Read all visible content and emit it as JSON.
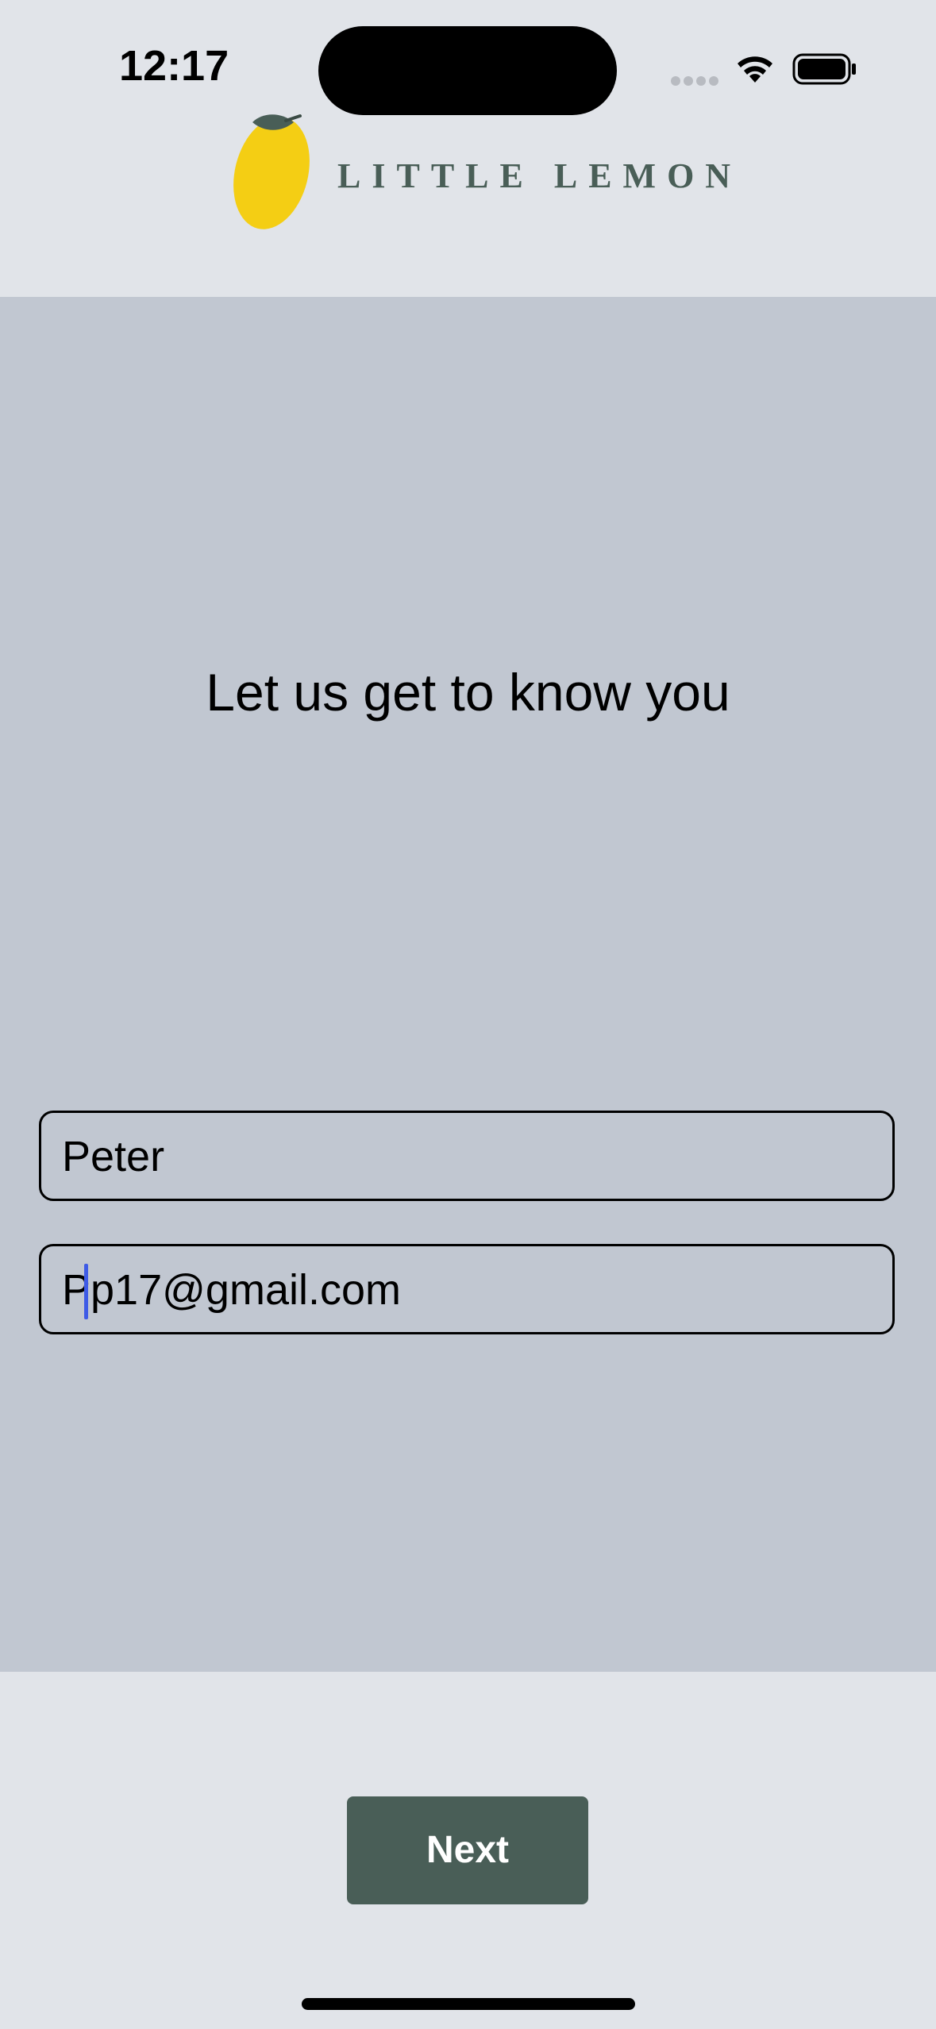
{
  "status_bar": {
    "time": "12:17"
  },
  "header": {
    "logo_text": "LITTLE LEMON",
    "logo_icon": "lemon-icon"
  },
  "form": {
    "title": "Let us get to know you",
    "first_name_value": "Peter",
    "email_value": "Pp17@gmail.com"
  },
  "actions": {
    "next_label": "Next"
  },
  "colors": {
    "brand_green": "#495e57",
    "lemon_yellow": "#f4ce14",
    "panel_bg": "#c1c7d1",
    "page_bg": "#e1e4e9"
  }
}
